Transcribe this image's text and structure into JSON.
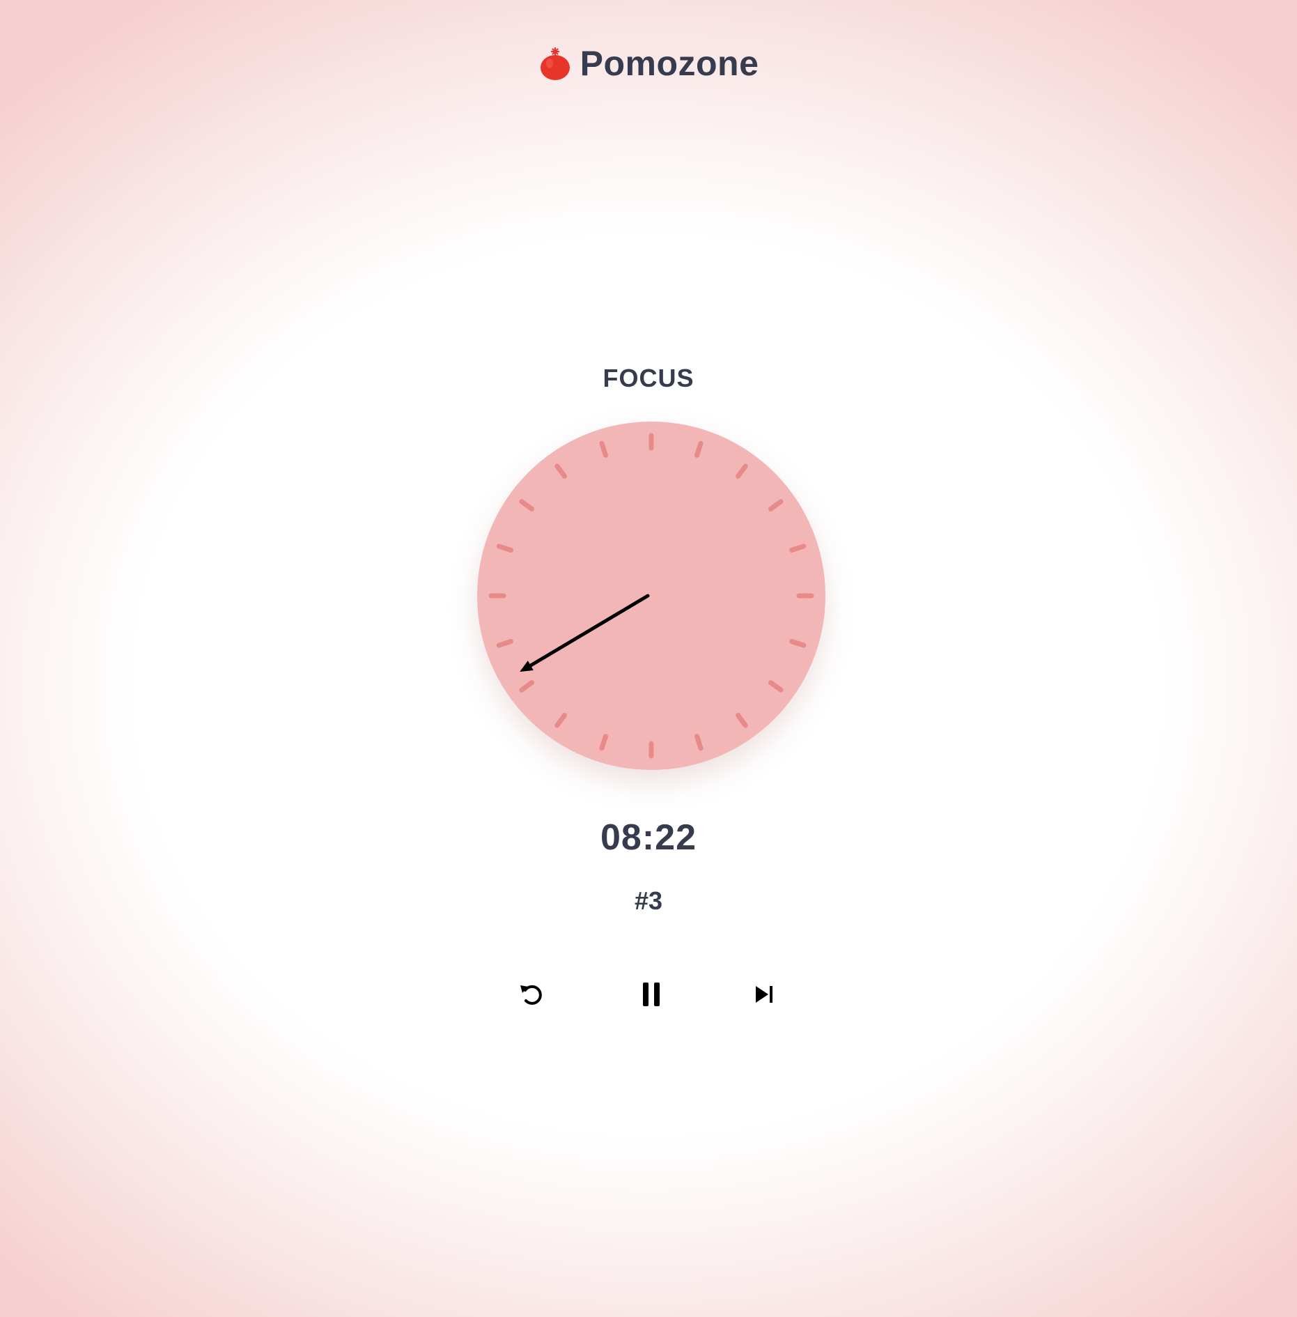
{
  "app": {
    "title": "Pomozone",
    "logo_icon": "tomato-icon"
  },
  "timer": {
    "mode_label": "FOCUS",
    "time_remaining": "08:22",
    "session_label": "#3",
    "hand_angle_degrees": 240,
    "tick_count": 20
  },
  "controls": {
    "reset_icon": "reset-icon",
    "pause_icon": "pause-icon",
    "skip_icon": "skip-next-icon"
  },
  "colors": {
    "dial_fill": "#f2b6b6",
    "tick_color": "#e88a8a",
    "hand_color": "#000000",
    "text_color": "#363c4e",
    "tomato_red": "#e8352a"
  }
}
